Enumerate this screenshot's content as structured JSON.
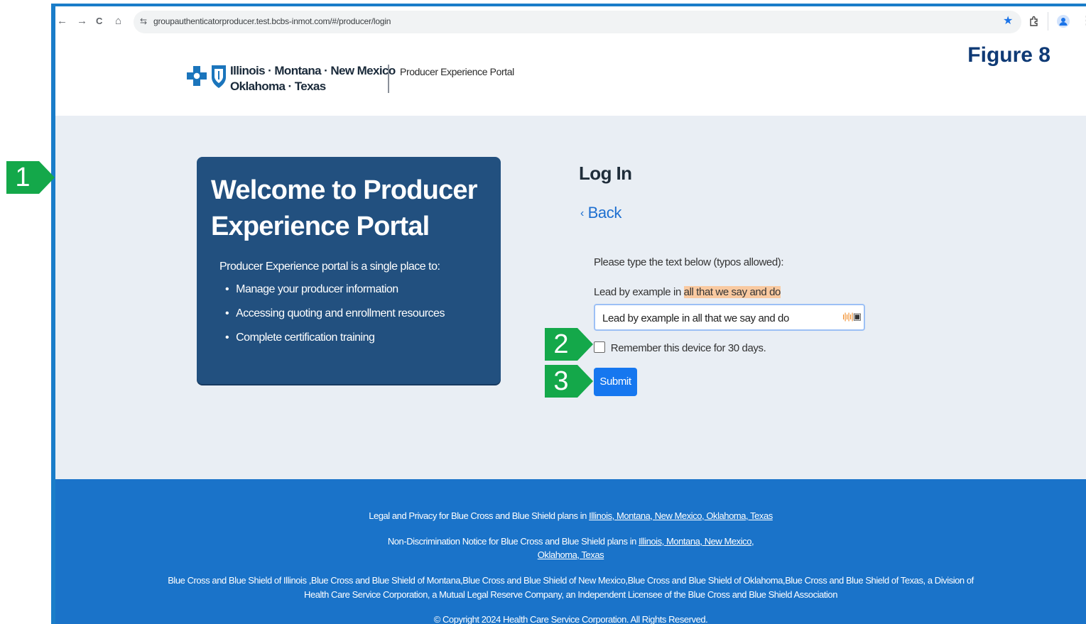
{
  "figure_label": "Figure 8",
  "browser": {
    "back": "←",
    "forward": "→",
    "reload": "C",
    "home": "⌂",
    "site_icon": "⇆",
    "url": "groupauthenticatorproducer.test.bcbs-inmot.com/#/producer/login",
    "icons": [
      "star-icon",
      "extension-icon",
      "profile-icon",
      "menu-icon"
    ]
  },
  "header": {
    "logo_line1": "Illinois · Montana · New Mexico",
    "logo_line2": "Oklahoma · Texas",
    "portal_name": "Producer Experience Portal"
  },
  "welcome": {
    "title": "Welcome to Producer Experience Portal",
    "intro": "Producer Experience portal is a single place to:",
    "items": [
      "Manage your producer information",
      "Accessing quoting and enrollment resources",
      "Complete certification training"
    ]
  },
  "login": {
    "title": "Log In",
    "back_label": "Back",
    "prompt": "Please type the text below (typos allowed):",
    "phrase_prefix": "Lead by example in ",
    "phrase_highlight": "all that we say and do",
    "input_value": "Lead by example in  all that we say and do",
    "remember_label": "Remember this device for 30 days.",
    "submit_label": "Submit"
  },
  "footer": {
    "line1_text": "Legal and Privacy for Blue Cross and Blue Shield plans in ",
    "line1_link": "Illinois, Montana, New Mexico, Oklahoma, Texas",
    "line2_text": "Non-Discrimination Notice for Blue Cross and Blue Shield plans in ",
    "line2_link_a": "Illinois, Montana, New Mexico,",
    "line2_link_b": "Oklahoma, Texas",
    "line3": "Blue Cross and Blue Shield of Illinois ,Blue Cross and Blue Shield of Montana,Blue Cross and Blue Shield of New Mexico,Blue Cross and Blue Shield of Oklahoma,Blue Cross and Blue Shield of Texas, a Division of",
    "line4": "Health Care Service Corporation, a Mutual Legal Reserve Company, an Independent Licensee of the Blue Cross and Blue Shield Association",
    "copyright": "© Copyright 2024 Health Care Service Corporation. All Rights Reserved."
  },
  "callouts": [
    "1",
    "2",
    "3"
  ],
  "colors": {
    "frame_border": "#1a7dc9",
    "card_bg": "#22507f",
    "footer_bg": "#1a73c9",
    "submit_bg": "#1677ef",
    "callout_bg": "#14a84a",
    "figure_label": "#0f3a75",
    "highlight": "#f9c9a0"
  }
}
